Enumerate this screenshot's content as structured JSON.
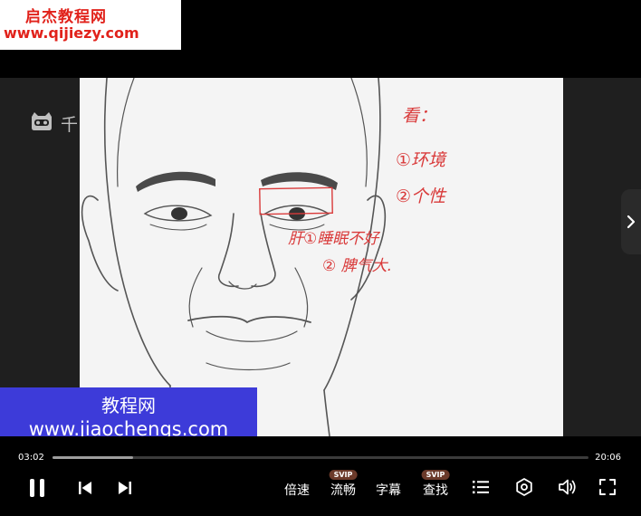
{
  "watermark": {
    "title": "启杰教程网",
    "url": "www.qijiezy.com"
  },
  "side_logo": {
    "text": "千"
  },
  "banner": {
    "title": "教程网",
    "url": "www.jiaochengs.com"
  },
  "annotations": {
    "line1": "看：",
    "line2": "①环境",
    "line3": "②个性",
    "line4": "肝①睡眠不好",
    "line5": "② 脾气大."
  },
  "player": {
    "current_time": "03:02",
    "total_time": "20:06",
    "progress_fraction": 0.151,
    "speed_label": "倍速",
    "quality_label": "流畅",
    "quality_badge": "SVIP",
    "subtitle_label": "字幕",
    "search_label": "查找",
    "search_badge": "SVIP"
  },
  "icons": {
    "pause": "pause-icon",
    "prev": "previous-icon",
    "next": "next-icon",
    "playlist": "playlist-icon",
    "settings": "settings-icon",
    "volume": "volume-icon",
    "fullscreen": "fullscreen-icon",
    "side_next": "chevron-right-icon"
  }
}
